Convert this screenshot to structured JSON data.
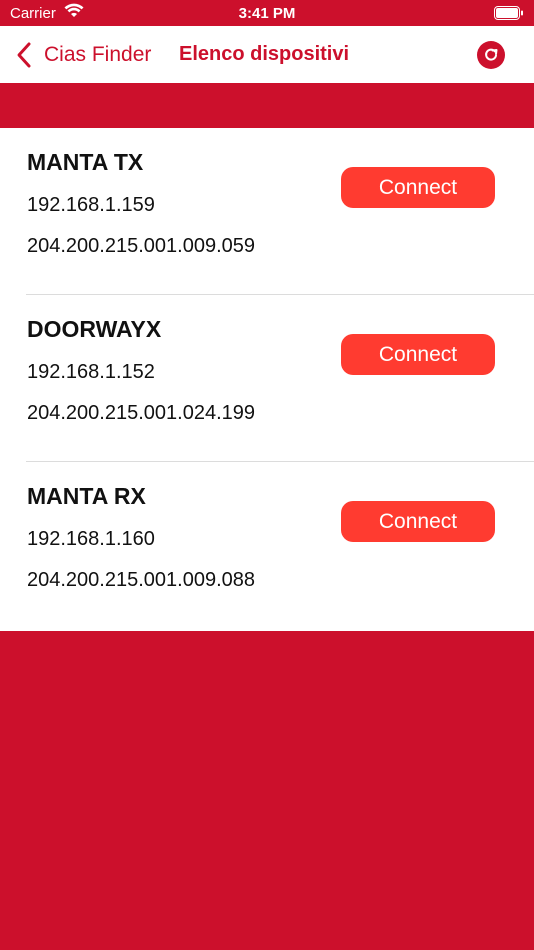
{
  "status_bar": {
    "carrier": "Carrier",
    "time": "3:41 PM"
  },
  "nav": {
    "back_label": "Cias Finder",
    "title": "Elenco dispositivi"
  },
  "colors": {
    "brand_red": "#cc102c",
    "button_red": "#ff3b30"
  },
  "devices": [
    {
      "name": "MANTA TX",
      "ip": "192.168.1.159",
      "id": "204.200.215.001.009.059",
      "action": "Connect"
    },
    {
      "name": "DOORWAYX",
      "ip": "192.168.1.152",
      "id": "204.200.215.001.024.199",
      "action": "Connect"
    },
    {
      "name": "MANTA RX",
      "ip": "192.168.1.160",
      "id": "204.200.215.001.009.088",
      "action": "Connect"
    }
  ]
}
